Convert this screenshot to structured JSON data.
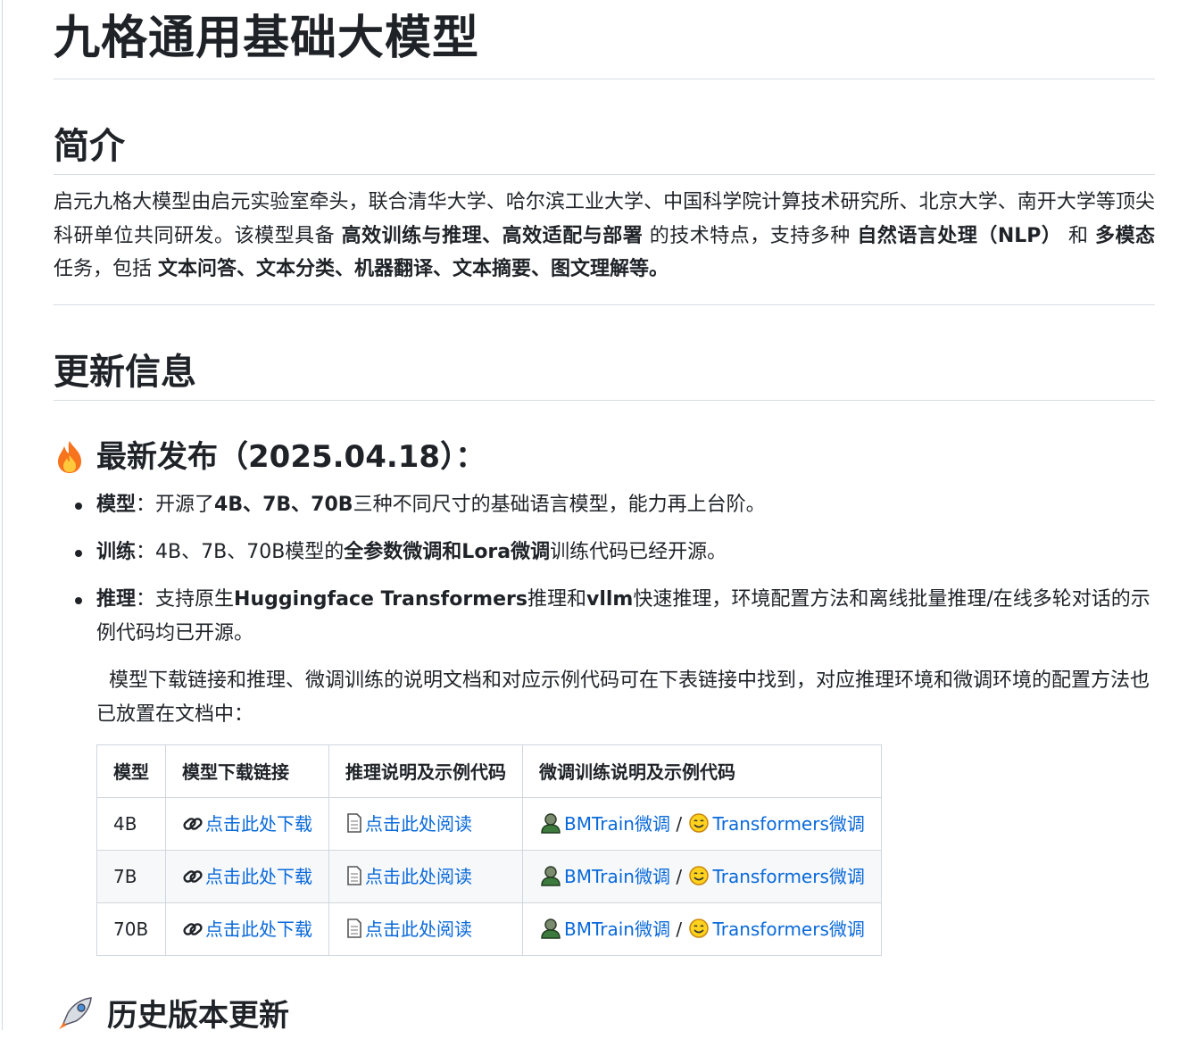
{
  "title": "九格通用基础大模型",
  "intro": {
    "heading": "简介",
    "p1": "启元九格大模型由启元实验室牵头，联合清华大学、哈尔滨工业大学、中国科学院计算技术研究所、北京大学、南开大学等顶尖科研单位共同研发。该模型具备 ",
    "b1": "高效训练与推理、高效适配与部署",
    "p2": " 的技术特点，支持多种 ",
    "b2": "自然语言处理（NLP）",
    "p3": " 和 ",
    "b3": "多模态",
    "p4": " 任务，包括 ",
    "b4": "文本问答、文本分类、机器翻译、文本摘要、图文理解等。"
  },
  "updates": {
    "heading": "更新信息",
    "release_heading": "最新发布（2025.04.18）：",
    "items": [
      {
        "label": "模型",
        "t1": "：开源了",
        "b1": "4B、7B、70B",
        "t2": "三种不同尺寸的基础语言模型，能力再上台阶。"
      },
      {
        "label": "训练",
        "t1": "：4B、7B、70B模型的",
        "b1": "全参数微调和Lora微调",
        "t2": "训练代码已经开源。"
      },
      {
        "label": "推理",
        "t1": "：支持原生",
        "b1": "Huggingface Transformers",
        "t2": "推理和",
        "b2": "vllm",
        "t3": "快速推理，环境配置方法和离线批量推理/在线多轮对话的示例代码均已开源。"
      }
    ],
    "note": "模型下载链接和推理、微调训练的说明文档和对应示例代码可在下表链接中找到，对应推理环境和微调环境的配置方法也已放置在文档中："
  },
  "table": {
    "headers": [
      "模型",
      "模型下载链接",
      "推理说明及示例代码",
      "微调训练说明及示例代码"
    ],
    "rows": [
      {
        "model": "4B",
        "download": "点击此处下载",
        "read": "点击此处阅读",
        "bmtrain": "BMTrain微调",
        "sep": "/",
        "transformers": "Transformers微调"
      },
      {
        "model": "7B",
        "download": "点击此处下载",
        "read": "点击此处阅读",
        "bmtrain": "BMTrain微调",
        "sep": "/",
        "transformers": "Transformers微调"
      },
      {
        "model": "70B",
        "download": "点击此处下载",
        "read": "点击此处阅读",
        "bmtrain": "BMTrain微调",
        "sep": "/",
        "transformers": "Transformers微调"
      }
    ]
  },
  "history_heading": "历史版本更新",
  "icons": {
    "release": "fire-icon",
    "download": "link-icon",
    "read": "document-icon",
    "bmtrain": "person-icon",
    "transformers": "hugging-face-icon",
    "history": "rocket-icon"
  },
  "colors": {
    "link": "#0969da",
    "text": "#1f2328",
    "border": "#d0d7de",
    "row_alt": "#f6f8fa"
  }
}
